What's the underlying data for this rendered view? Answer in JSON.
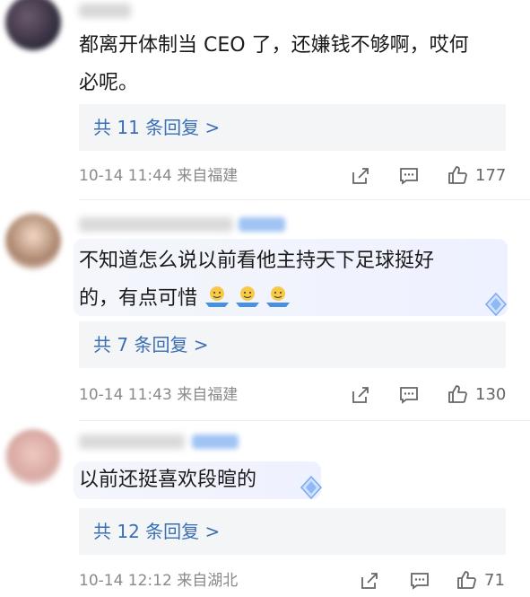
{
  "comments": [
    {
      "text_line1": "都离开体制当 CEO 了，还嫌钱不够啊，哎何",
      "text_line2": "必呢。",
      "replies_label": "共 11 条回复 >",
      "meta": "10-14 11:44  来自福建",
      "likes": "177"
    },
    {
      "text_line1": "不知道怎么说以前看他主持天下足球挺好",
      "text_line2": "的，有点可惜",
      "replies_label": "共 7 条回复 >",
      "meta": "10-14 11:43  来自福建",
      "likes": "130"
    },
    {
      "text_line1": "以前还挺喜欢段暄的",
      "replies_label": "共 12 条回复 >",
      "meta": "10-14 12:12  来自湖北",
      "likes": "71"
    }
  ],
  "icons": [
    "share-icon",
    "comment-icon",
    "like-icon",
    "emoji-icon",
    "diamond-badge-icon"
  ],
  "colors": {
    "link": "#3a6fb5",
    "meta": "#8a8a8a",
    "reply_bg": "#f4f5f7"
  }
}
